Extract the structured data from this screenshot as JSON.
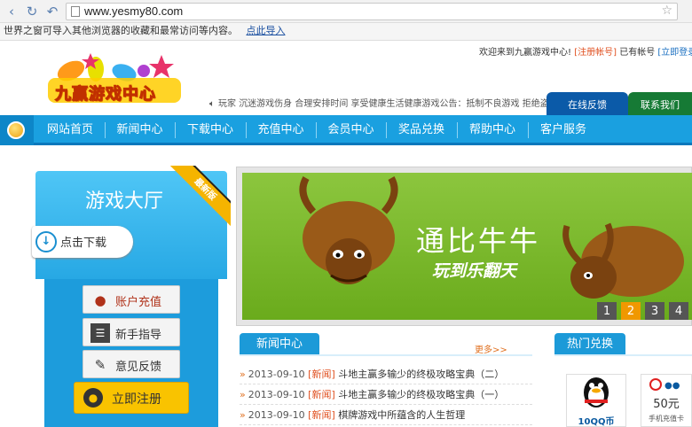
{
  "browser": {
    "url": "www.yesmy80.com",
    "import_text": "世界之窗可导入其他浏览器的收藏和最常访问等内容。",
    "import_link": "点此导入"
  },
  "header": {
    "welcome": "欢迎来到九赢游戏中心!",
    "register_link": "[注册帐号]",
    "have_account": "已有帐号",
    "login_link": "[立即登录]",
    "logo_text": "九赢游戏中心",
    "notice": "玩家 沉迷游戏伤身 合理安排时间 享受健康生活健康游戏公告：抵制不良游戏 拒绝盗版",
    "feedback_tab": "在线反馈",
    "contact_tab": "联系我们"
  },
  "nav": {
    "items": [
      "网站首页",
      "新闻中心",
      "下载中心",
      "充值中心",
      "会员中心",
      "奖品兑换",
      "帮助中心",
      "客户服务"
    ]
  },
  "hall": {
    "title": "游戏大厅",
    "ribbon": "最新版",
    "download": "点击下载"
  },
  "sidebar": {
    "recharge": "账户充值",
    "guide": "新手指导",
    "feedback": "意见反馈",
    "register": "立即注册"
  },
  "banner": {
    "title": "通比牛牛",
    "subtitle": "玩到乐翻天",
    "pages": [
      "1",
      "2",
      "3",
      "4"
    ],
    "active_page": "2"
  },
  "news": {
    "title": "新闻中心",
    "more": "更多>>",
    "items": [
      {
        "date": "2013-09-10",
        "tag": "[新闻]",
        "title": "斗地主赢多输少的终极攻略宝典（二）"
      },
      {
        "date": "2013-09-10",
        "tag": "[新闻]",
        "title": "斗地主赢多输少的终极攻略宝典（一）"
      },
      {
        "date": "2013-09-10",
        "tag": "[新闻]",
        "title": "棋牌游戏中所蕴含的人生哲理"
      }
    ]
  },
  "exchange": {
    "title": "热门兑换",
    "item1": "10QQ币",
    "item2": "50元",
    "item2_sub": "手机充值卡"
  }
}
